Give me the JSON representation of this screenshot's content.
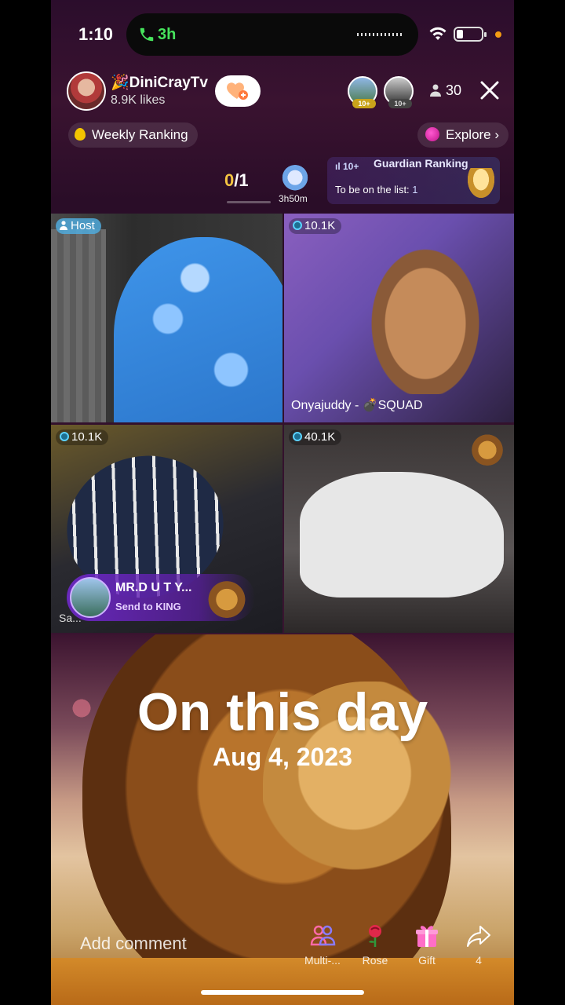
{
  "status_bar": {
    "time": "1:10",
    "call_time": "3h"
  },
  "header": {
    "host_name": "🎉DiniCrayTv",
    "host_likes": "8.9K likes",
    "viewer_badges": [
      "10+",
      "10+"
    ],
    "viewer_count": "30"
  },
  "ranking": {
    "weekly_label": "Weekly Ranking",
    "explore_label": "Explore",
    "score_current": "0",
    "score_total": "/1",
    "timer": "3h50m",
    "guardian_badge": "ıl 10+",
    "guardian_title": "Guardian Ranking",
    "guardian_sub": "To be on the list:",
    "guardian_value": "1"
  },
  "tiles": [
    {
      "label": "Host"
    },
    {
      "label": "10.1K",
      "name": "Onyajuddy - 💣SQUAD"
    },
    {
      "label": "10.1K",
      "name": "Sa..."
    },
    {
      "label": "40.1K"
    }
  ],
  "gift_banner": {
    "sender": "MR.D U T Y...",
    "text": "Send to KING"
  },
  "memory": {
    "title": "On this day",
    "date": "Aug 4, 2023"
  },
  "bottom_bar": {
    "comment_placeholder": "Add comment",
    "multi_label": "Multi-...",
    "rose_label": "Rose",
    "gift_label": "Gift",
    "share_label": "4"
  },
  "colors": {
    "accent_green": "#46e35c",
    "score_gold": "#f4c542",
    "host_tag": "#50aadc",
    "gift_purple": "#6e28c8"
  }
}
